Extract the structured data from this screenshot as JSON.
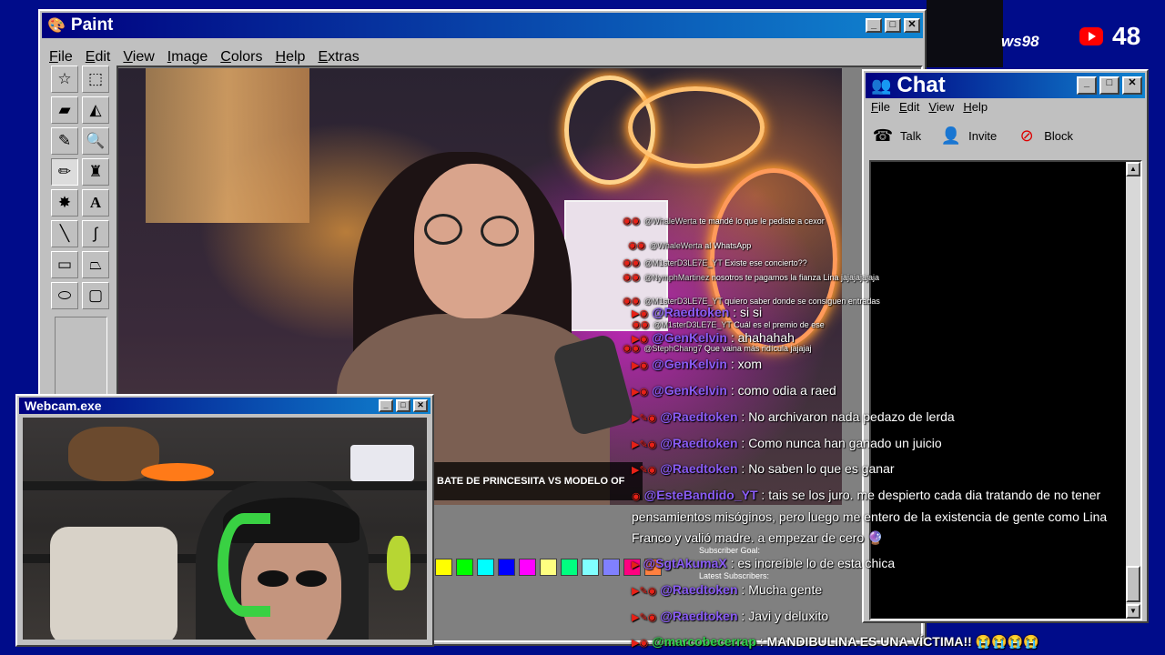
{
  "paint": {
    "title": "Paint",
    "menu": [
      "File",
      "Edit",
      "View",
      "Image",
      "Colors",
      "Help",
      "Extras"
    ],
    "ticker_text": "BATE DE PRINCESIITA VS MODELO OF"
  },
  "webcam": {
    "title": "Webcam.exe"
  },
  "chat_window": {
    "title": "Chat",
    "menu": [
      "File",
      "Edit",
      "View",
      "Help"
    ],
    "toolbar": {
      "talk": "Talk",
      "invite": "Invite",
      "block": "Block"
    }
  },
  "stream": {
    "viewer_count": "48",
    "os_label": "ws98"
  },
  "palette_colors": [
    "#ffff00",
    "#00ff00",
    "#00ffff",
    "#0000ff",
    "#ff00ff",
    "#ffff80",
    "#00ff80",
    "#80ffff",
    "#8080ff",
    "#ff0080",
    "#ff8040"
  ],
  "overlay": {
    "subscriber_goal": "Subscriber Goal:",
    "latest_subscribers": "Latest Subscribers:"
  },
  "chat_messages": [
    {
      "user": "@WhaleWerta",
      "text": "te mandé lo que le pediste a cexor",
      "size": "small"
    },
    {
      "user": "@WhaleWerta",
      "text": "al WhatsApp",
      "size": "small"
    },
    {
      "user": "@M1sterD3LE7E_YT",
      "text": "Existe ese concierto??",
      "size": "small"
    },
    {
      "user": "@NymphMartinez",
      "text": "nosotros te pagamos la fianza Lina jajajajajaja",
      "size": "small"
    },
    {
      "user": "@M1sterD3LE7E_YT",
      "text": "quiero saber donde se consiguen entradas",
      "size": "small"
    },
    {
      "user": "@Raedtoken",
      "text": "si si",
      "size": "normal"
    },
    {
      "user": "@M1sterD3LE7E_YT",
      "text": "Cuál es el premio de ese",
      "size": "small"
    },
    {
      "user": "@GenKelvin",
      "text": "ahahahah",
      "size": "normal"
    },
    {
      "user": "@StephChang7",
      "text": "Que vaina más ridícula jajajaj",
      "size": "small"
    },
    {
      "user": "@GenKelvin",
      "text": "xom",
      "size": "normal"
    },
    {
      "user": "@GenKelvin",
      "text": "como odia a raed",
      "size": "normal"
    },
    {
      "user": "@Raedtoken",
      "text": "No archivaron nada pedazo de lerda",
      "size": "normal"
    },
    {
      "user": "@Raedtoken",
      "text": "Como nunca han ganado un juicio",
      "size": "normal"
    },
    {
      "user": "@Raedtoken",
      "text": "No saben lo que es ganar",
      "size": "normal"
    },
    {
      "user": "@EsteBandido_YT",
      "text": "tais se los juro. me despierto cada dia tratando de no tener",
      "size": "normal"
    },
    {
      "user": "",
      "text": "pensamientos misóginos, pero luego me entero de la existencia de gente como Lina",
      "size": "normal"
    },
    {
      "user": "",
      "text": "Franco y valió madre. a empezar de cero 🔮",
      "size": "normal"
    },
    {
      "user": "@SgtAkumaX",
      "text": "es increíble lo de esta chica",
      "size": "normal"
    },
    {
      "user": "@Raedtoken",
      "text": "Mucha gente",
      "size": "normal"
    },
    {
      "user": "@Raedtoken",
      "text": "Javi y deluxito",
      "size": "normal"
    },
    {
      "user": "@marcobecerrap",
      "text": "MANDIBULINA ES UNA VÍCTIMA!! 😭😭😭😭",
      "size": "big"
    }
  ]
}
